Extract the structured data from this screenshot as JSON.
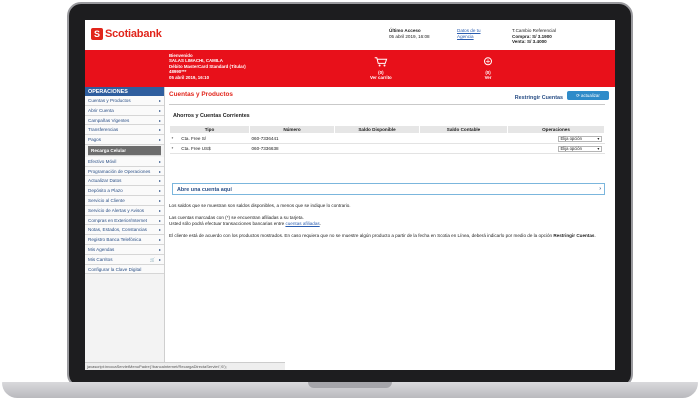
{
  "brand": {
    "logo_mark": "S",
    "name": "Scotiabank"
  },
  "topbar": {
    "last_access_label": "Último Acceso",
    "last_access_value": "05 abril 2019, 16:08",
    "agency_link_1": "Datos de tu",
    "agency_link_2": "Agencia",
    "fx_title": "T.Cambio Referencial",
    "fx_buy": "Compra: S/ 3.1900",
    "fx_sell": "Venta: S/ 3.4000"
  },
  "user": {
    "greeting": "Bienvenido",
    "name": "SALAS LIMACHI, CAMILA",
    "card": "Débito MasterCard Standard (Titular)",
    "card_number": "48990***",
    "datetime": "05 abril 2019, 16:10"
  },
  "carts": [
    {
      "count": "(0)",
      "label": "Ver carrito"
    },
    {
      "count": "(0)",
      "label": "Ver"
    }
  ],
  "sidebar": {
    "title": "OPERACIONES",
    "items": [
      "Cuentas y Productos",
      "Abrir Cuenta",
      "Campañas Vigentes",
      "Transferencias",
      "Pagos",
      "Recarga Celular",
      "Efectivo Móvil",
      "Programación de Operaciones",
      "Actualizar Datos",
      "Depósito a Plazo",
      "Servicio al Cliente",
      "Servicio de Alertas y Avisos",
      "Compras en Exterior/Internet",
      "Notas, Estados, Constancias",
      "Registro Banca Telefónica",
      "Mis Agendas",
      "Mis Carritos",
      "Configurar la Clave Digital"
    ]
  },
  "main": {
    "title": "Cuentas y Productos",
    "restrict_link": "Restringir Cuentas",
    "refresh_button": "actualizar",
    "section": "Ahorros y Cuentas Corrientes",
    "table": {
      "headers": [
        "Tipo",
        "Número",
        "Saldo Disponible",
        "Saldo Contable",
        "Operaciones"
      ],
      "rows": [
        {
          "mark": "*",
          "type": "Cta. Free S/",
          "number": "060-7336441",
          "op": "Elija opción"
        },
        {
          "mark": "*",
          "type": "Cta. Free US$",
          "number": "060-7336638",
          "op": "Elija opción"
        }
      ]
    },
    "open_account": "Abre una cuenta aquí",
    "note1": "Los saldos que se muestran son saldos disponibles, a menos que se indique lo contrario.",
    "note2a": "Las cuentas marcadas con (*) se encuentran afiliadas a su tarjeta.",
    "note2b": "Usted sólo podrá efectuar transacciones bancarias entre",
    "note2link": "cuentas afiliadas",
    "note3": "El cliente está de acuerdo con los productos mostrados. En caso requiera que no se muestre algún producto a partir de la fecha en Scotia en Línea, deberá indicarlo por medio de la opción",
    "note3b": "Restringir Cuentas"
  },
  "statusbar": "javascript:invocaServletMenuPadre('/bancaInternet/RecargaDirectaServlet','6');"
}
